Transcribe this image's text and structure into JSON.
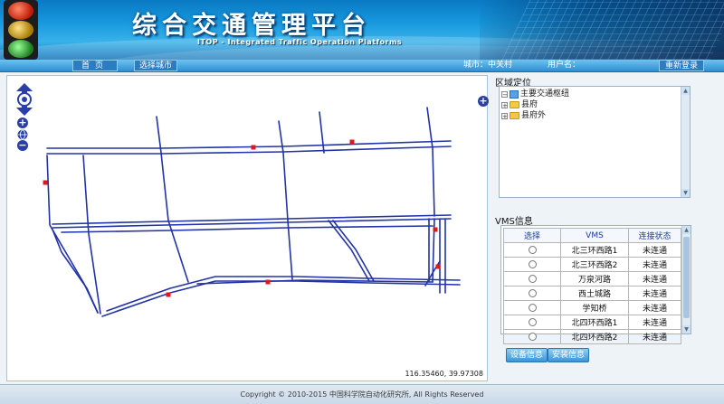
{
  "header": {
    "title": "综合交通管理平台",
    "subtitle": "ITOP - Integrated Traffic Operation Platforms"
  },
  "nav": {
    "home": "首页",
    "select_city": "选择城市",
    "city_info": "城市：中关村",
    "user_name": "用户名：",
    "relogin": "重新登录"
  },
  "map": {
    "coordinates": "116.35460, 39.97308",
    "zoom_in": "+",
    "zoom_out": "−",
    "expand": "+"
  },
  "tree": {
    "title": "区域定位",
    "items": [
      {
        "label": "主要交通枢纽",
        "toggle": "−"
      },
      {
        "label": "县府",
        "toggle": "+"
      },
      {
        "label": "县府外",
        "toggle": "+"
      }
    ]
  },
  "vms": {
    "title": "VMS信息",
    "headers": [
      "选择",
      "VMS",
      "连接状态"
    ],
    "rows": [
      {
        "name": "北三环西路1",
        "status": "未连通"
      },
      {
        "name": "北三环西路2",
        "status": "未连通"
      },
      {
        "name": "万泉河路",
        "status": "未连通"
      },
      {
        "name": "西土城路",
        "status": "未连通"
      },
      {
        "name": "学知桥",
        "status": "未连通"
      },
      {
        "name": "北四环西路1",
        "status": "未连通"
      },
      {
        "name": "北四环西路2",
        "status": "未连通"
      }
    ],
    "device_button": "设备信息",
    "install_button": "安装信息"
  },
  "footer": {
    "copyright": "Copyright © 2010-2015 中国科学院自动化研究所, All Rights Reserved"
  },
  "colors": {
    "road": "#2233a6",
    "marker": "#e0181c",
    "accent": "#1596dc"
  }
}
